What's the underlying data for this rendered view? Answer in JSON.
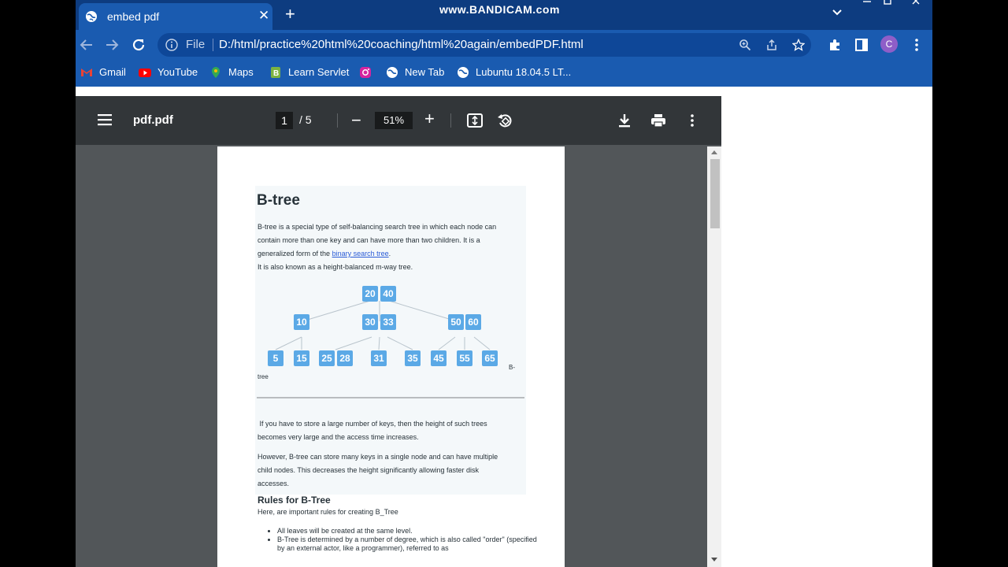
{
  "browser": {
    "tab_title": "embed pdf",
    "tab_close": "✕",
    "new_tab": "+",
    "watermark": "www.BANDICAM.com",
    "url_scheme": "File",
    "url": "D:/html/practice%20html%20coaching/html%20again/embedPDF.html",
    "profile_initial": "C"
  },
  "bookmarks": [
    {
      "label": "Gmail",
      "icon": "gmail-icon",
      "color": "#ea4335"
    },
    {
      "label": "YouTube",
      "icon": "youtube-icon",
      "color": "#ff0000"
    },
    {
      "label": "Maps",
      "icon": "maps-icon",
      "color": "#34a853"
    },
    {
      "label": "Learn Servlet",
      "icon": "servlet-icon",
      "color": "#7cb342"
    },
    {
      "label": "",
      "icon": "instagram-icon",
      "color": "#d6249f"
    },
    {
      "label": "New Tab",
      "icon": "globe-icon",
      "color": "#ffffff"
    },
    {
      "label": "Lubuntu 18.04.5 LT...",
      "icon": "globe-icon",
      "color": "#ffffff"
    }
  ],
  "pdf_viewer": {
    "file_name": "pdf.pdf",
    "current_page": "1",
    "page_total": "/ 5",
    "zoom_out": "−",
    "zoom": "51%",
    "zoom_in": "+"
  },
  "pdf_page": {
    "heading": "B-tree",
    "intro_line1": "B-tree is a special type of self-balancing search tree in which each node can",
    "intro_line2": "contain more than one key and can have more than two children. It is a",
    "intro_line3_pre": "generalized form of the",
    "intro_link": "binary search tree",
    "intro_line3_post": ".",
    "intro_line4": "It is also known as a height-balanced m-way tree.",
    "tree_nodes": {
      "root": [
        "20",
        "40"
      ],
      "level1": [
        [
          "10"
        ],
        [
          "30",
          "33"
        ],
        [
          "50",
          "60"
        ]
      ],
      "leaves": [
        [
          "5"
        ],
        [
          "15"
        ],
        [
          "25",
          "28"
        ],
        [
          "31"
        ],
        [
          "35"
        ],
        [
          "45"
        ],
        [
          "55"
        ],
        [
          "65"
        ]
      ]
    },
    "caption_right": "B-",
    "caption_left": "tree",
    "para1_line1": " If you have to store a large number of keys, then the height of such trees",
    "para1_line2": "becomes very large and the access time increases.",
    "para2_line1": "However, B-tree can store many keys in a single node and can have multiple",
    "para2_line2": "child nodes. This decreases the height significantly allowing faster disk",
    "para2_line3": "accesses.",
    "rules_heading": "Rules for B-Tree",
    "rules_intro": "Here, are important rules for creating B_Tree",
    "rules": [
      "All leaves will be created at the same level.",
      "B-Tree is determined by a number of degree, which is also called \"order\" (specified by an external actor, like a programmer), referred to as"
    ]
  },
  "colors": {
    "tab_strip": "#0d3c80",
    "toolbar": "#1a5bb0",
    "viewer_toolbar": "#323639",
    "viewer_bg": "#525659",
    "node": "#5ba9e6"
  }
}
